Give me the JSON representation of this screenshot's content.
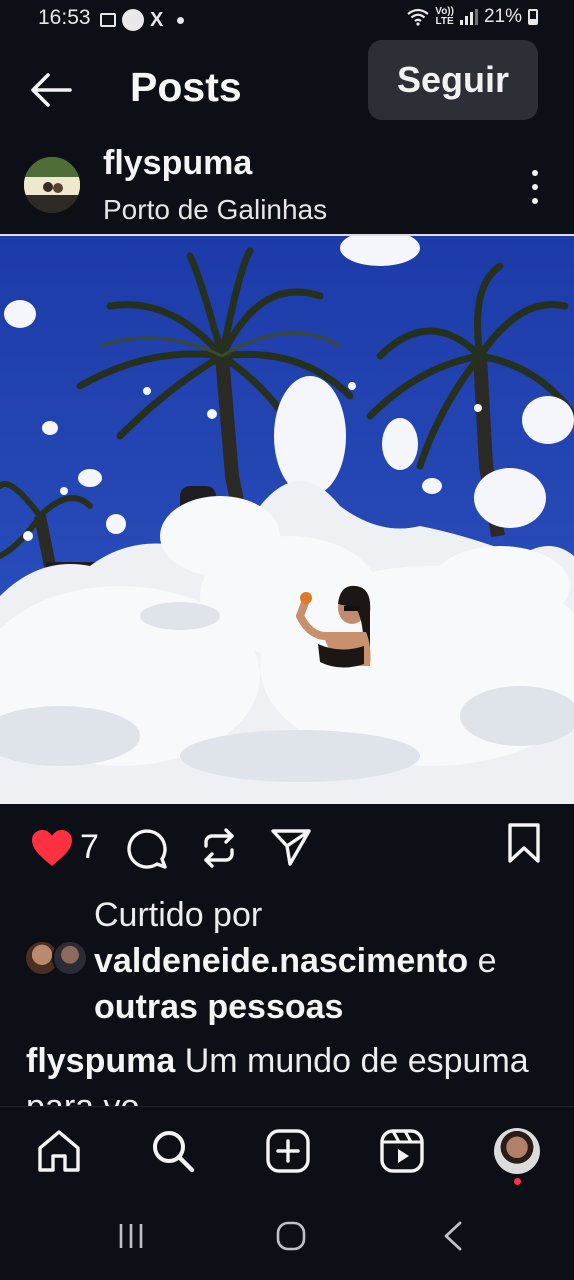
{
  "status_bar": {
    "time": "16:53",
    "notification_x": "X",
    "lte_top": "Vo))",
    "lte_bottom": "LTE",
    "battery": "21%"
  },
  "header": {
    "title": "Posts",
    "follow_label": "Seguir"
  },
  "post": {
    "username": "flyspuma",
    "location": "Porto de Galinhas",
    "likes_count": "7",
    "liked_by_prefix": "Curtido por",
    "liked_by_user": "valdeneide.nascimento",
    "liked_by_suffix_connector": "e",
    "liked_by_suffix": "outras pessoas",
    "caption_user": "flyspuma",
    "caption_text": "Um mundo de espuma para vo..."
  },
  "colors": {
    "background": "#0c0f16",
    "like_red": "#ff3040",
    "follow_button": "#2c2f36",
    "sky": "#1f3fa6"
  },
  "icons": {
    "back": "arrow-left-icon",
    "more": "more-vertical-icon",
    "like": "heart-filled-icon",
    "comment": "comment-icon",
    "share": "repost-icon",
    "send": "send-icon",
    "save": "bookmark-icon",
    "home": "home-icon",
    "search": "search-icon",
    "create": "plus-square-icon",
    "reels": "reels-icon",
    "sys_recent": "recent-apps-icon",
    "sys_home": "home-circle-icon",
    "sys_back": "chevron-left-icon"
  }
}
